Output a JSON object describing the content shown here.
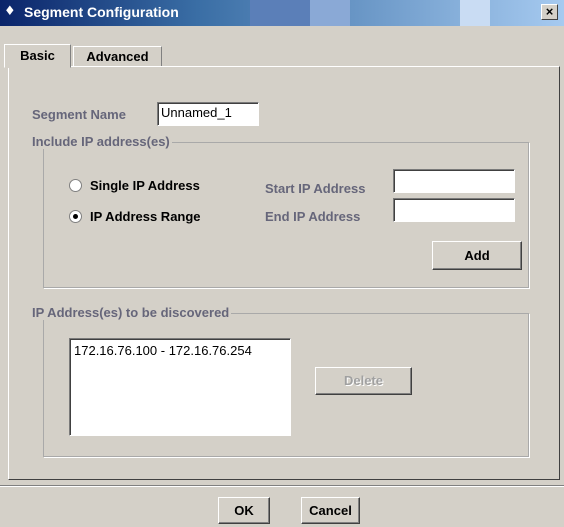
{
  "window": {
    "title": "Segment Configuration",
    "title_icon": "app-icon",
    "close_label": "×"
  },
  "tabs": [
    {
      "label": "Basic"
    },
    {
      "label": "Advanced"
    }
  ],
  "form": {
    "segment_name_label": "Segment Name",
    "segment_name_value": "Unnamed_1",
    "include_group_title": "Include IP address(es)",
    "radio_single_label": "Single IP Address",
    "radio_range_label": "IP Address  Range",
    "start_ip_label": "Start IP Address",
    "end_ip_label": "End  IP Address",
    "start_ip_value": "",
    "end_ip_value": "",
    "add_label": "Add",
    "selected_mode": "IP Address Range"
  },
  "discovered": {
    "group_title": "IP Address(es) to be discovered",
    "items": [
      "172.16.76.100 - 172.16.76.254"
    ],
    "delete_label": "Delete"
  },
  "footer": {
    "ok_label": "OK",
    "cancel_label": "Cancel"
  }
}
